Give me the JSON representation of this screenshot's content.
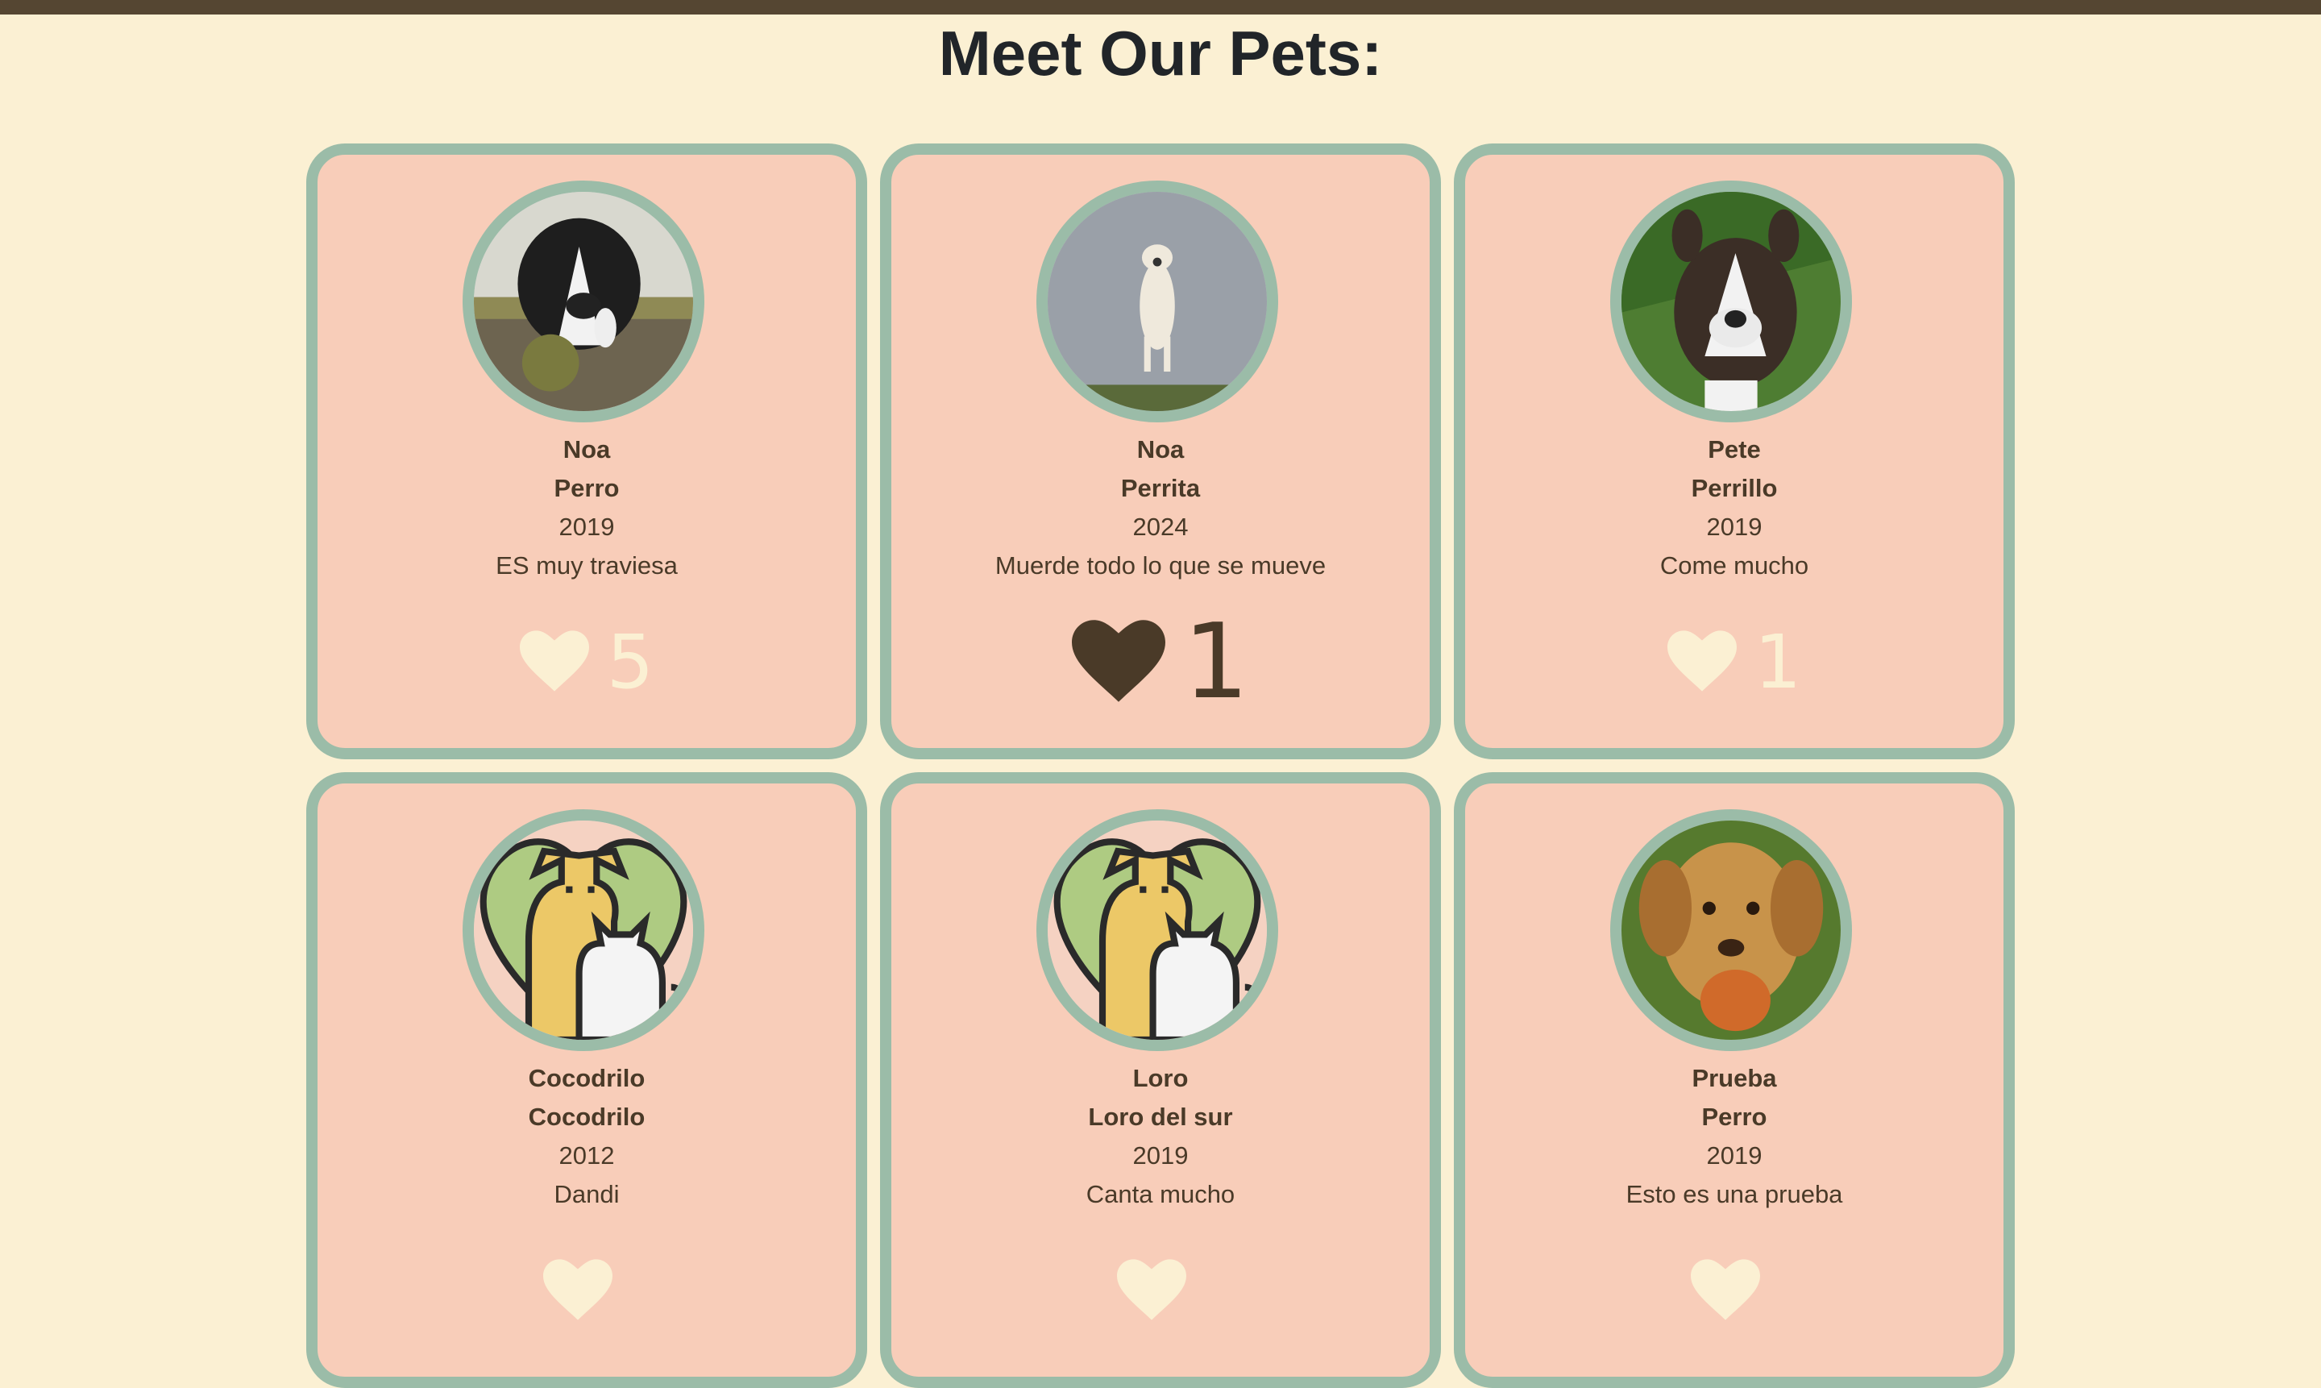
{
  "header": {
    "title": "Meet Our Pets:"
  },
  "colors": {
    "background": "#fbf0d3",
    "topbar": "#554632",
    "card": "#f8cdb9",
    "border": "#9bbca8",
    "text": "#4a3a28",
    "heart_active": "#4a3a28",
    "heart_inactive": "#fbf0d3"
  },
  "pets": [
    {
      "name": "Noa",
      "type": "Perro",
      "year": "2019",
      "description": "ES muy traviesa",
      "likes": "5",
      "liked": false,
      "photo": "border-collie-running-with-ball"
    },
    {
      "name": "Noa",
      "type": "Perrita",
      "year": "2024",
      "description": "Muerde todo lo que se mueve",
      "likes": "1",
      "liked": true,
      "photo": "white-dog-jumping"
    },
    {
      "name": "Pete",
      "type": "Perrillo",
      "year": "2019",
      "description": "Come mucho",
      "likes": "1",
      "liked": false,
      "photo": "boston-terrier-puppy"
    },
    {
      "name": "Cocodrilo",
      "type": "Cocodrilo",
      "year": "2012",
      "description": "Dandi",
      "likes": "",
      "liked": false,
      "photo": "dog-and-cat-illustration"
    },
    {
      "name": "Loro",
      "type": "Loro del sur",
      "year": "2019",
      "description": "Canta mucho",
      "likes": "",
      "liked": false,
      "photo": "dog-and-cat-illustration"
    },
    {
      "name": "Prueba",
      "type": "Perro",
      "year": "2019",
      "description": "Esto es una prueba",
      "likes": "",
      "liked": false,
      "photo": "golden-puppy-with-toy"
    }
  ]
}
